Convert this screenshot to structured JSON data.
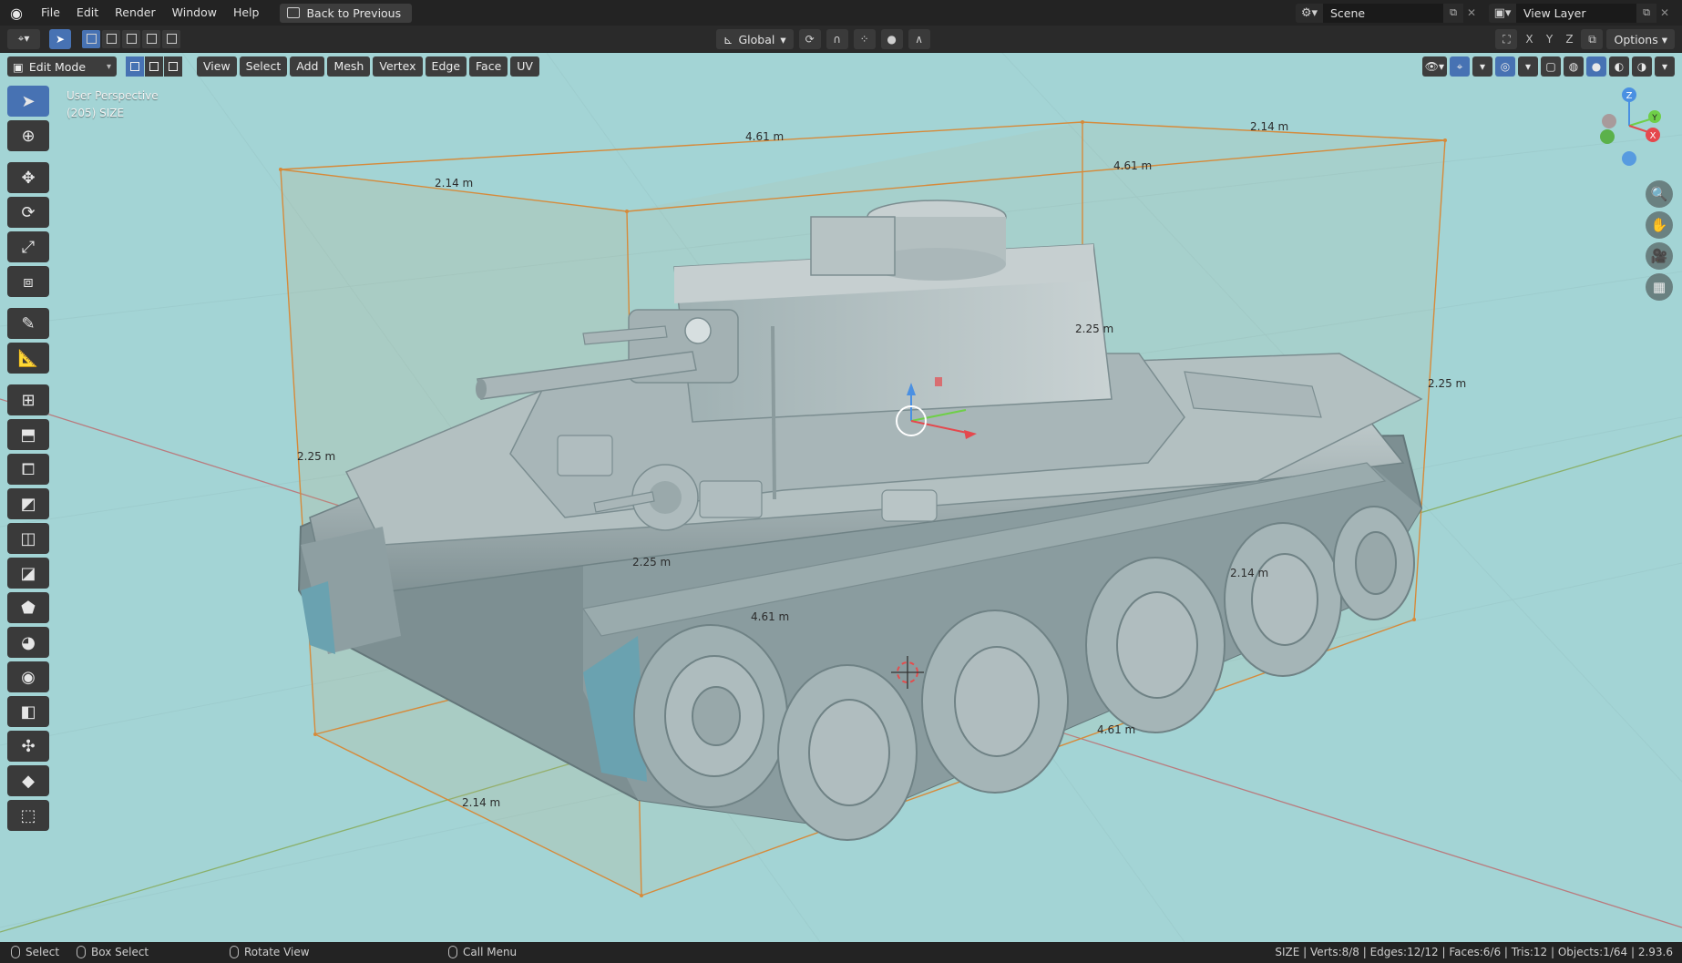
{
  "menu": {
    "items": [
      "File",
      "Edit",
      "Render",
      "Window",
      "Help"
    ],
    "back_button": "Back to Previous"
  },
  "scene": {
    "label": "Scene"
  },
  "view_layer": {
    "label": "View Layer"
  },
  "header": {
    "transform_orientation": "Global",
    "axes": [
      "X",
      "Y",
      "Z"
    ],
    "options_label": "Options"
  },
  "viewport_header": {
    "mode": "Edit Mode",
    "menus": [
      "View",
      "Select",
      "Add",
      "Mesh",
      "Vertex",
      "Edge",
      "Face",
      "UV"
    ]
  },
  "viewport_info": {
    "view_name": "User Perspective",
    "object_label": "(205) SIZE"
  },
  "dimensions": [
    "4.61 m",
    "2.14 m",
    "4.61 m",
    "2.14 m",
    "2.25 m",
    "2.25 m",
    "2.25 m",
    "2.25 m",
    "4.61 m",
    "2.14 m",
    "4.61 m",
    "2.14 m"
  ],
  "gizmo": {
    "x": "X",
    "y": "Y",
    "z": "Z"
  },
  "status_bar": {
    "select": "Select",
    "box_select": "Box Select",
    "rotate_view": "Rotate View",
    "call_menu": "Call Menu",
    "stats": "SIZE | Verts:8/8 | Edges:12/12 | Faces:6/6 | Tris:12 | Objects:1/64 | 2.93.6"
  },
  "colors": {
    "viewport_bg": "#a3d4d5",
    "bbox_edge": "#d68a3a",
    "accent": "#4772b3",
    "tank": "#8fa3a6"
  }
}
